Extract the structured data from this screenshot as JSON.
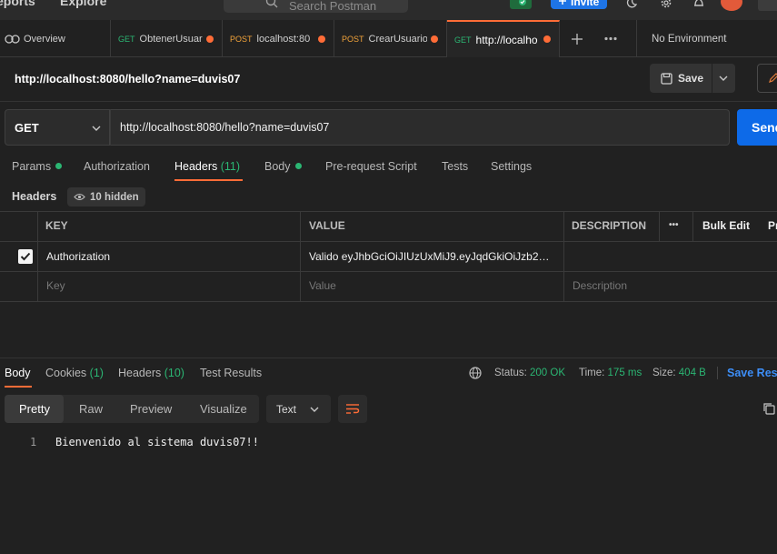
{
  "topbar": {
    "reports_label": "eports",
    "explore_label": "Explore",
    "search_placeholder": "Search Postman",
    "invite_label": "Invite"
  },
  "tabs": [
    {
      "label": "Overview"
    },
    {
      "method": "GET",
      "label": "ObtenerUsuar"
    },
    {
      "method": "POST",
      "label": "localhost:80"
    },
    {
      "method": "POST",
      "label": "CrearUsuario"
    },
    {
      "method": "GET",
      "label": "http://localho"
    }
  ],
  "environment": "No Environment",
  "request": {
    "title": "http://localhost:8080/hello?name=duvis07",
    "save_label": "Save",
    "method": "GET",
    "url": "http://localhost:8080/hello?name=duvis07",
    "send_label": "Send"
  },
  "request_tabs": {
    "params": "Params",
    "authorization": "Authorization",
    "headers": "Headers",
    "headers_count": "(11)",
    "body": "Body",
    "prerequest": "Pre-request Script",
    "tests": "Tests",
    "settings": "Settings"
  },
  "headers_section": {
    "label": "Headers",
    "hidden": "10 hidden"
  },
  "table": {
    "col_key": "KEY",
    "col_value": "VALUE",
    "col_description": "DESCRIPTION",
    "more": "•••",
    "bulk_edit": "Bulk Edit",
    "presets": "Pr",
    "row": {
      "key": "Authorization",
      "value": "Valido eyJhbGciOiJIUzUxMiJ9.eyJqdGkiOiJzb2…"
    },
    "placeholder": {
      "key": "Key",
      "value": "Value",
      "description": "Description"
    }
  },
  "response": {
    "tabs": {
      "body": "Body",
      "cookies": "Cookies",
      "cookies_count": "(1)",
      "headers": "Headers",
      "headers_count": "(10)",
      "tests": "Test Results"
    },
    "status_label": "Status:",
    "status_value": "200 OK",
    "time_label": "Time:",
    "time_value": "175 ms",
    "size_label": "Size:",
    "size_value": "404 B",
    "save_response": "Save Resp",
    "formats": [
      "Pretty",
      "Raw",
      "Preview",
      "Visualize"
    ],
    "language": "Text",
    "line_number": "1",
    "body_text": "Bienvenido al sistema duvis07!!"
  },
  "colors": {
    "accent": "#ff6c37",
    "get": "#2bb673",
    "post": "#f2a33a",
    "primary": "#0d6ae8"
  }
}
